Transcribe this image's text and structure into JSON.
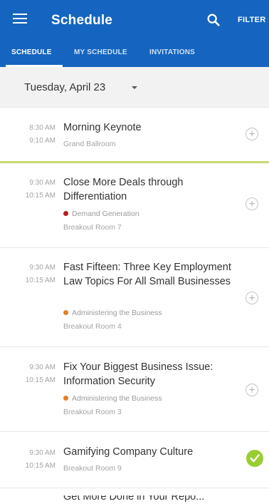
{
  "appbar": {
    "title": "Schedule",
    "filter_label": "FILTER",
    "menu_icon": "hamburger-icon",
    "search_icon": "search-icon",
    "color": "#1565c0"
  },
  "tabs": [
    {
      "label": "SCHEDULE",
      "active": true
    },
    {
      "label": "MY SCHEDULE",
      "active": false
    },
    {
      "label": "INVITATIONS",
      "active": false
    }
  ],
  "date_selector": {
    "value": "Tuesday, April 23"
  },
  "sessions": [
    {
      "start": "8:30 AM",
      "end": "9:10 AM",
      "title": "Morning Keynote",
      "track": "",
      "track_color": "",
      "room": "Grand Ballroom",
      "status": "add"
    },
    {
      "start": "9:30 AM",
      "end": "10:15 AM",
      "title": "Close More Deals through Differentiation",
      "track": "Demand Generation",
      "track_color": "#b71c1c",
      "room": "Breakout Room 7",
      "status": "add"
    },
    {
      "start": "9:30 AM",
      "end": "10:15 AM",
      "title": "Fast Fifteen: Three Key Employment Law Topics For All Small Businesses",
      "track": "Administering the Business",
      "track_color": "#e67e22",
      "room": "Breakout Room 4",
      "status": "add"
    },
    {
      "start": "9:30 AM",
      "end": "10:15 AM",
      "title": "Fix Your Biggest Business Issue: Information Security",
      "track": "Administering the Business",
      "track_color": "#e67e22",
      "room": "Breakout Room 3",
      "status": "add"
    },
    {
      "start": "9:30 AM",
      "end": "10:15 AM",
      "title": "Gamifying Company Culture",
      "track": "",
      "track_color": "",
      "room": "Breakout Room 9",
      "status": "added"
    },
    {
      "start": "",
      "end": "",
      "title": "Get More Done in Your Repo...",
      "track": "",
      "track_color": "",
      "room": "",
      "status": ""
    }
  ],
  "add_symbol": "+",
  "accent_color": "#c8d97a",
  "added_color": "#9acd32"
}
